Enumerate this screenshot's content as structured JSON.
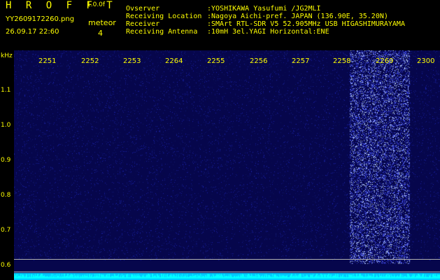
{
  "header": {
    "app_title": "H R O F F T",
    "version": "1.0.0f",
    "filename": "YY2609172260.png",
    "datetime": "26.09.17 22:60",
    "counter_label": "meteor",
    "counter_value": "4",
    "info_labels": "Ovserver\nReceiving Location\nReceiver\nReceiving Antenna",
    "info_values": ":YOSHIKAWA Yasufumi /JG2MLI\n:Nagoya Aichi-pref. JAPAN (136.90E, 35.20N)\n:SMArt RTL-SDR V5 52.905MHz USB HIGASHIMURAYAMA\n:10mH 3el.YAGI Horizontal:ENE"
  },
  "axis": {
    "y_unit": "kHz",
    "y_ticks": [
      "1.1",
      "1.0",
      "0.9",
      "0.8",
      "0.7",
      "0.6"
    ],
    "x_ticks": [
      "2251",
      "2252",
      "2253",
      "2264",
      "2255",
      "2256",
      "2257",
      "2258",
      "2269",
      "2300"
    ]
  },
  "colors": {
    "text": "#ffff00",
    "background": "#050540",
    "signal": "#00ffff"
  }
}
